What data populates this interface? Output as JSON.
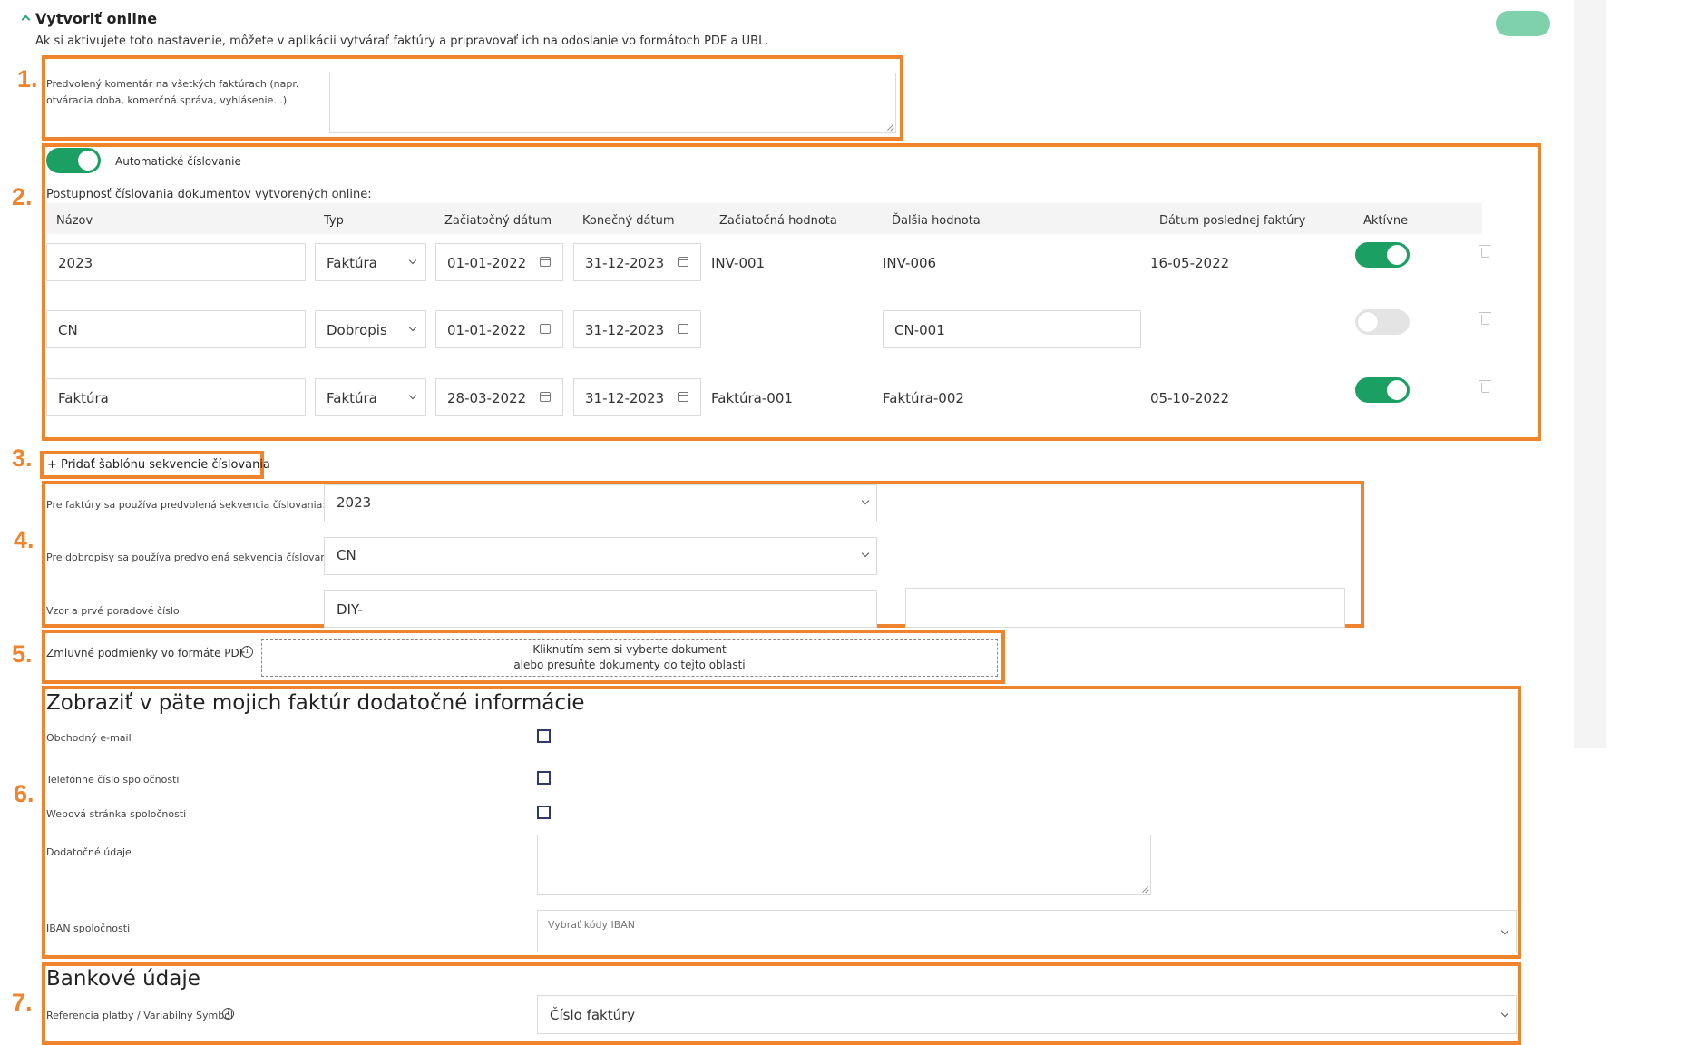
{
  "header": {
    "title": "Vytvoriť online",
    "description": "Ak si aktivujete toto nastavenie, môžete v aplikácii vytvárať faktúry a pripravovať ich na odoslanie vo formátoch PDF a UBL.",
    "toggle_state": "on"
  },
  "step_labels": [
    "1.",
    "2.",
    "3.",
    "4.",
    "5.",
    "6.",
    "7."
  ],
  "section1": {
    "comment_label": "Predvolený komentár na všetkých faktúrach (napr. otváracia doba, komerčná správa, vyhlásenie...)",
    "comment_value": ""
  },
  "section2": {
    "auto_numbering_label": "Automatické číslovanie",
    "auto_numbering_on": true,
    "sequence_title": "Postupnosť číslovania dokumentov vytvorených online:",
    "columns": {
      "name": "Názov",
      "type": "Typ",
      "start_date": "Začiatočný dátum",
      "end_date": "Konečný dátum",
      "start_value": "Začiatočná hodnota",
      "next_value": "Ďalšia hodnota",
      "last_invoice_date": "Dátum poslednej faktúry",
      "active": "Aktívne"
    },
    "rows": [
      {
        "name": "2023",
        "type": "Faktúra",
        "start_date": "01-01-2022",
        "end_date": "31-12-2023",
        "start_value": "INV-001",
        "next_value": "INV-006",
        "last_invoice_date": "16-05-2022",
        "active": true
      },
      {
        "name": "CN",
        "type": "Dobropis",
        "start_date": "01-01-2022",
        "end_date": "31-12-2023",
        "start_value": "",
        "next_value": "CN-001",
        "last_invoice_date": "",
        "active": false
      },
      {
        "name": "Faktúra",
        "type": "Faktúra",
        "start_date": "28-03-2022",
        "end_date": "31-12-2023",
        "start_value": "Faktúra-001",
        "next_value": "Faktúra-002",
        "last_invoice_date": "05-10-2022",
        "active": true
      }
    ]
  },
  "section3": {
    "add_template_label": "+ Pridať šablónu sekvencie číslovania"
  },
  "section4": {
    "invoice_default_label": "Pre faktúry sa používa predvolená sekvencia číslovania:",
    "invoice_default_value": "2023",
    "credit_default_label": "Pre dobropisy sa používa predvolená sekvencia číslovania:",
    "credit_default_value": "CN",
    "pattern_label": "Vzor a prvé poradové číslo",
    "pattern_value": "DIY-",
    "first_number_value": ""
  },
  "section5": {
    "pdf_terms_label": "Zmluvné podmienky vo formáte PDF",
    "upload_line1": "Kliknutím sem si vyberte dokument",
    "upload_line2": "alebo presuňte dokumenty do tejto oblasti"
  },
  "section6": {
    "title": "Zobraziť v päte mojich faktúr dodatočné informácie",
    "business_email_label": "Obchodný e-mail",
    "phone_label": "Telefónne číslo spoločnosti",
    "website_label": "Webová stránka spoločnosti",
    "additional_label": "Dodatočné údaje",
    "additional_value": "",
    "iban_label": "IBAN spoločnosti",
    "iban_placeholder": "Vybrať kódy IBAN"
  },
  "section7": {
    "title": "Bankové údaje",
    "payment_ref_label": "Referencia platby / Variabilný Symbol",
    "payment_ref_value": "Číslo faktúry"
  },
  "colors": {
    "highlight": "#f0842c",
    "toggle_on": "#1b9f63",
    "header_toggle": "#7fd1ac"
  }
}
